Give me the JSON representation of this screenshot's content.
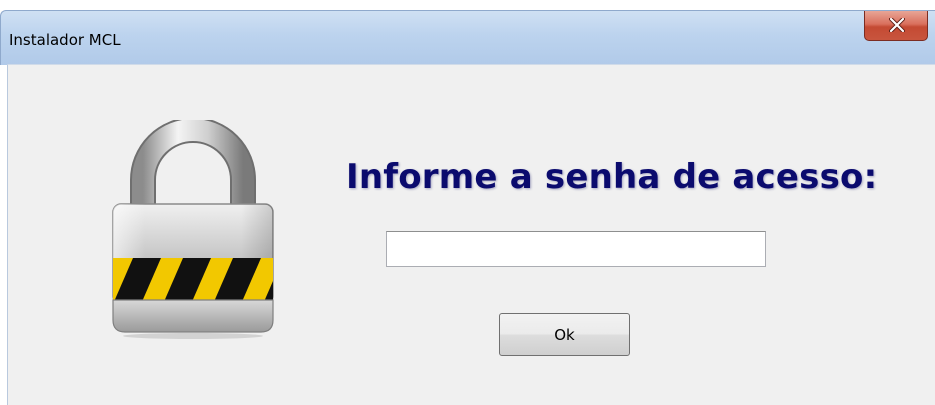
{
  "window": {
    "title": "Instalador MCL",
    "close_icon": "close-x-icon"
  },
  "dialog": {
    "lock_icon": "padlock-icon",
    "prompt": "Informe a senha de acesso:",
    "password_value": "",
    "ok_label": "Ok"
  },
  "colors": {
    "prompt_text": "#0b0b6e",
    "titlebar": "#bcd3ee",
    "close_button": "#c44a33",
    "client_bg": "#f0f0f0"
  }
}
